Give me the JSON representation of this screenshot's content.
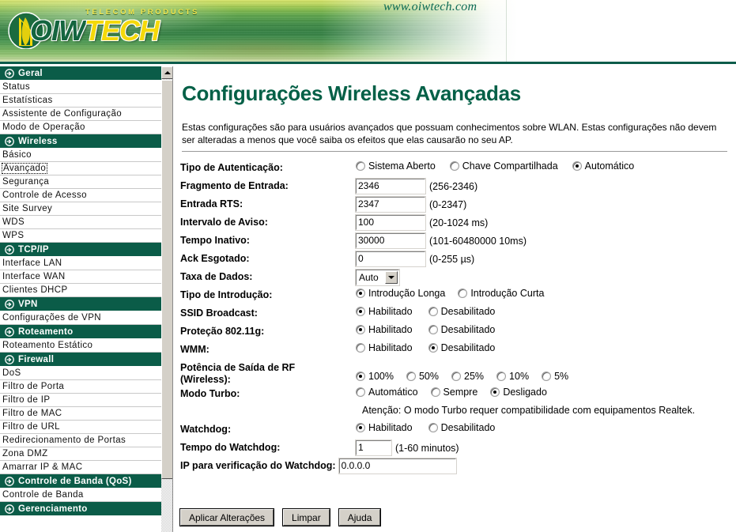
{
  "header": {
    "logo_tagline": "TELECOM PRODUCTS",
    "logo_primary": "OIW",
    "logo_secondary": "TECH",
    "site_url": "www.oiwtech.com"
  },
  "sidebar": {
    "groups": [
      {
        "label": "Geral",
        "items": [
          "Status",
          "Estatísticas",
          "Assistente de Configuração",
          "Modo de Operação"
        ]
      },
      {
        "label": "Wireless",
        "items": [
          "Básico",
          "Avançado",
          "Segurança",
          "Controle de Acesso",
          "Site Survey",
          "WDS",
          "WPS"
        ]
      },
      {
        "label": "TCP/IP",
        "items": [
          "Interface LAN",
          "Interface WAN",
          "Clientes DHCP"
        ]
      },
      {
        "label": "VPN",
        "items": [
          "Configurações de VPN"
        ]
      },
      {
        "label": "Roteamento",
        "items": [
          "Roteamento Estático"
        ]
      },
      {
        "label": "Firewall",
        "items": [
          "DoS",
          "Filtro de Porta",
          "Filtro de IP",
          "Filtro de MAC",
          "Filtro de URL",
          "Redirecionamento de Portas",
          "Zona DMZ",
          "Amarrar IP & MAC"
        ]
      },
      {
        "label": "Controle de Banda (QoS)",
        "items": [
          "Controle de Banda"
        ]
      },
      {
        "label": "Gerenciamento",
        "items": []
      }
    ],
    "selected_item": "Avançado"
  },
  "main": {
    "title": "Configurações Wireless Avançadas",
    "intro": "Estas configurações são para usuários avançados que possuam conhecimentos sobre WLAN. Estas configurações não devem ser alteradas a menos que você saiba os efeitos que elas causarão no seu AP.",
    "fields": {
      "auth_type": {
        "label": "Tipo de Autenticação:",
        "options": [
          "Sistema Aberto",
          "Chave Compartilhada",
          "Automático"
        ],
        "selected": "Automático"
      },
      "fragment_threshold": {
        "label": "Fragmento de Entrada:",
        "value": "2346",
        "hint": "(256-2346)"
      },
      "rts_threshold": {
        "label": "Entrada RTS:",
        "value": "2347",
        "hint": "(0-2347)"
      },
      "beacon_interval": {
        "label": "Intervalo de Aviso:",
        "value": "100",
        "hint": "(20-1024 ms)"
      },
      "inactivity_time": {
        "label": "Tempo Inativo:",
        "value": "30000",
        "hint": "(101-60480000 10ms)"
      },
      "ack_timeout": {
        "label": "Ack Esgotado:",
        "value": "0",
        "hint": "(0-255 µs)"
      },
      "data_rate": {
        "label": "Taxa de Dados:",
        "value": "Auto",
        "options": [
          "Auto"
        ]
      },
      "preamble_type": {
        "label": "Tipo de Introdução:",
        "options": [
          "Introdução Longa",
          "Introdução Curta"
        ],
        "selected": "Introdução Longa"
      },
      "ssid_broadcast": {
        "label": "SSID Broadcast:",
        "options": [
          "Habilitado",
          "Desabilitado"
        ],
        "selected": "Habilitado"
      },
      "protection_80211g": {
        "label": "Proteção 802.11g:",
        "options": [
          "Habilitado",
          "Desabilitado"
        ],
        "selected": "Habilitado"
      },
      "wmm": {
        "label": "WMM:",
        "options": [
          "Habilitado",
          "Desabilitado"
        ],
        "selected": "Desabilitado"
      },
      "rf_output_power": {
        "label_line1": "Potência de Saída de RF",
        "label_line2": "(Wireless):",
        "options": [
          "100%",
          "50%",
          "25%",
          "10%",
          "5%"
        ],
        "selected": "100%"
      },
      "turbo_mode": {
        "label": "Modo Turbo:",
        "options": [
          "Automático",
          "Sempre",
          "Desligado"
        ],
        "selected": "Desligado",
        "note": "Atenção: O modo Turbo requer compatibilidade com equipamentos Realtek."
      },
      "watchdog": {
        "label": "Watchdog:",
        "options": [
          "Habilitado",
          "Desabilitado"
        ],
        "selected": "Habilitado"
      },
      "watchdog_time": {
        "label": "Tempo do Watchdog:",
        "value": "1",
        "hint": "(1-60 minutos)"
      },
      "watchdog_ip": {
        "label": "IP para verificação do Watchdog:",
        "value": "0.0.0.0"
      }
    },
    "buttons": {
      "apply": "Aplicar Alterações",
      "reset": "Limpar",
      "help": "Ajuda"
    }
  },
  "colors": {
    "brand_green": "#0b5c48",
    "title_green": "#046047",
    "logo_yellow": "#f5d90a"
  }
}
